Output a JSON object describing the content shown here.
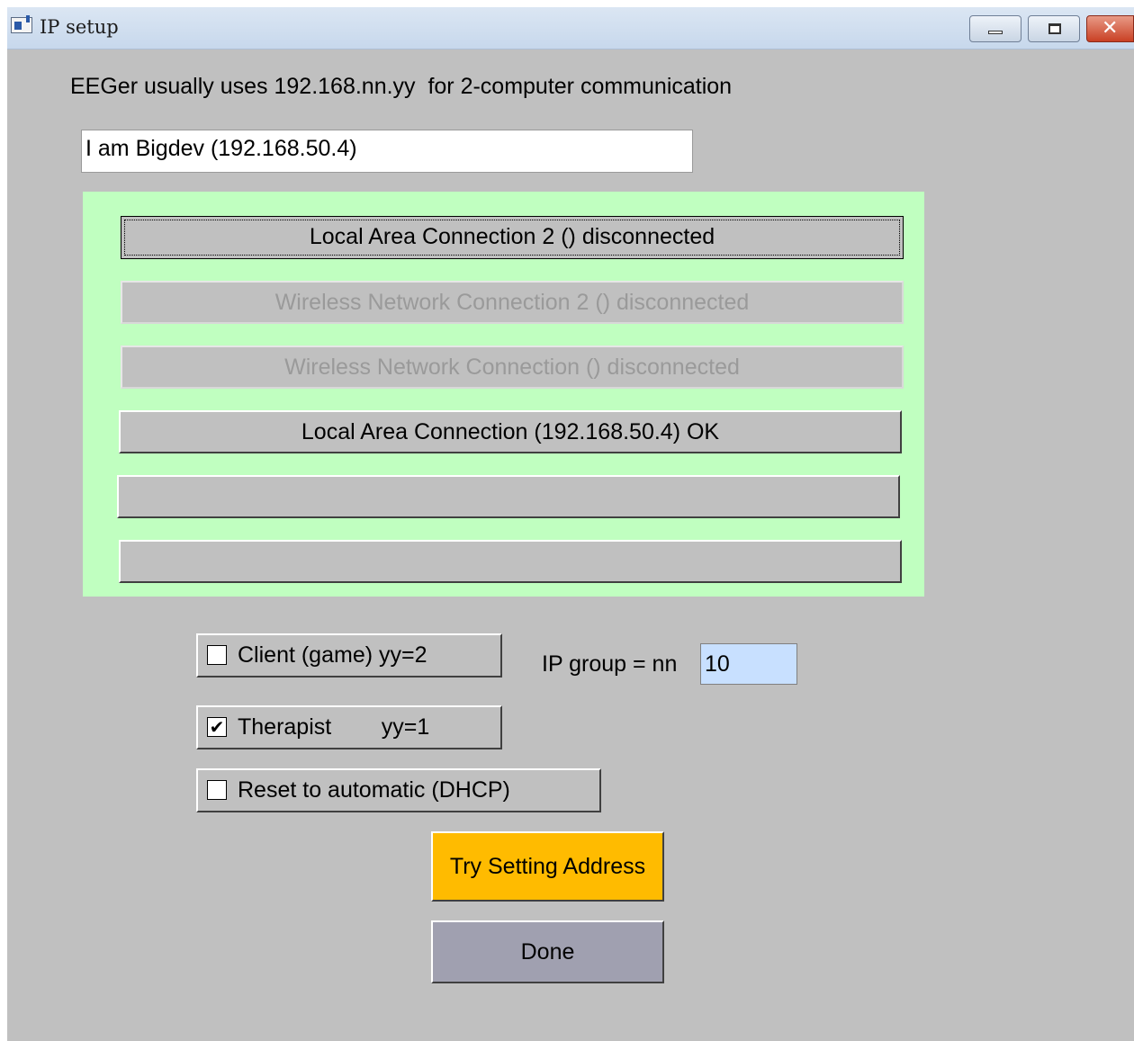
{
  "window": {
    "title": "IP setup",
    "icon": "app-window-icon",
    "controls": {
      "minimize": "minimize-icon",
      "maximize": "maximize-icon",
      "close": "close-icon",
      "close_glyph": "✕"
    }
  },
  "info_text": "EEGer usually uses 192.168.nn.yy  for 2-computer communication",
  "identity_field": {
    "value": "I am Bigdev (192.168.50.4)"
  },
  "connections": {
    "panel_color": "#c0ffc0",
    "items": [
      {
        "label": "Local Area Connection 2 () disconnected",
        "enabled": true,
        "focused": true
      },
      {
        "label": "Wireless Network Connection 2 () disconnected",
        "enabled": false
      },
      {
        "label": "Wireless Network Connection () disconnected",
        "enabled": false
      },
      {
        "label": "Local Area Connection (192.168.50.4) OK",
        "enabled": true
      },
      {
        "label": "",
        "enabled": true
      },
      {
        "label": "",
        "enabled": true
      }
    ]
  },
  "options": {
    "client": {
      "label": "Client (game) yy=2",
      "checked": false,
      "mark": ""
    },
    "therapist": {
      "label": "Therapist        yy=1",
      "checked": true,
      "mark": "✔"
    },
    "dhcp": {
      "label": "Reset to automatic (DHCP)",
      "checked": false,
      "mark": ""
    }
  },
  "ip_group": {
    "label": "IP group = nn",
    "value": "10",
    "field_color": "#c8e0ff"
  },
  "actions": {
    "try_label": "Try Setting Address",
    "try_color": "#ffbb00",
    "done_label": "Done",
    "done_color": "#a0a0b0"
  }
}
